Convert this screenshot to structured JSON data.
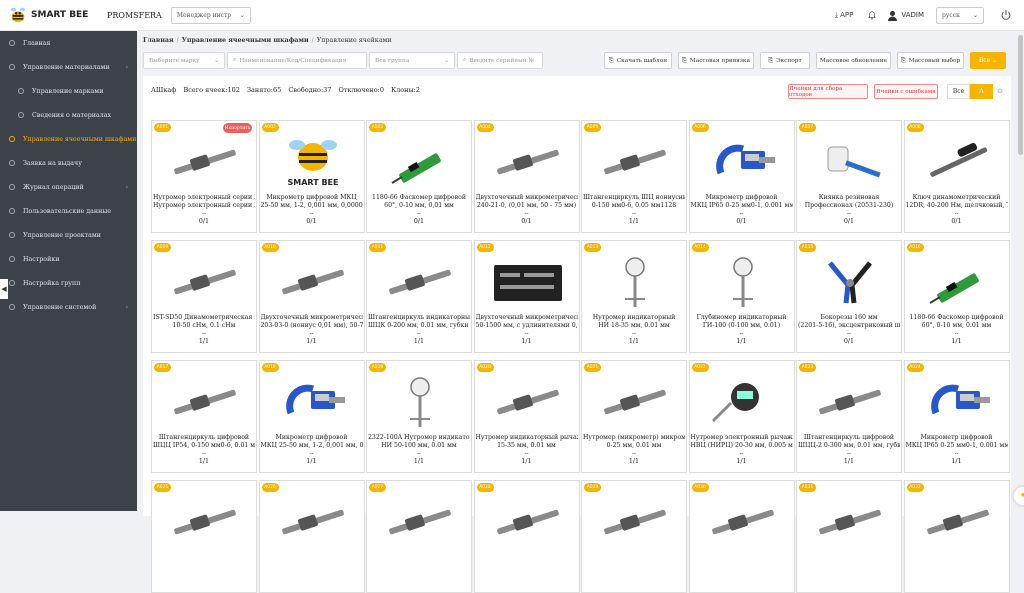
{
  "brand": {
    "name": "SMART BEE",
    "org": "PROMSFERA",
    "role_select": "Менеджер инстр",
    "accent": "#f5b400"
  },
  "header": {
    "app": "APP",
    "user": "VADIM",
    "lang": "русск"
  },
  "sidebar": {
    "items": [
      {
        "label": "Главная",
        "active": false,
        "sub": false,
        "arrow": false
      },
      {
        "label": "Управление материалами",
        "active": false,
        "sub": false,
        "arrow": true
      },
      {
        "label": "Управление марками",
        "active": false,
        "sub": true,
        "arrow": false
      },
      {
        "label": "Сведения о материалах",
        "active": false,
        "sub": true,
        "arrow": false
      },
      {
        "label": "Управление ячеечными шкафами",
        "active": true,
        "sub": false,
        "arrow": false
      },
      {
        "label": "Заявка на выдачу",
        "active": false,
        "sub": false,
        "arrow": false
      },
      {
        "label": "Журнал операций",
        "active": false,
        "sub": false,
        "arrow": true
      },
      {
        "label": "Пользовательские данные",
        "active": false,
        "sub": false,
        "arrow": false
      },
      {
        "label": "Управление проектами",
        "active": false,
        "sub": false,
        "arrow": false
      },
      {
        "label": "Настройки",
        "active": false,
        "sub": false,
        "arrow": false
      },
      {
        "label": "Настройка групп",
        "active": false,
        "sub": false,
        "arrow": false
      },
      {
        "label": "Управление системой",
        "active": false,
        "sub": false,
        "arrow": true
      }
    ]
  },
  "breadcrumb": {
    "home": "Главная",
    "section": "Управление ячеечными шкафами",
    "page": "Управление ячейками"
  },
  "filters": {
    "brand": "Выберите марку",
    "search": "Наименование/Код/Спецификация",
    "group": "Вся группа",
    "serial": "Введите серийный №"
  },
  "actions": {
    "download": "Скачать шаблон",
    "bulk_bind": "Массовая привязка",
    "export": "Экспорт",
    "bulk_update": "Массовое обновление",
    "bulk_select": "Массовый выбор",
    "all": "Все"
  },
  "stats": {
    "cabinet": "АШкаф",
    "total": "Всего ячеек:102",
    "busy": "Занято:65",
    "free": "Свободно:37",
    "off": "Отключено:0",
    "clones": "Клоны:2"
  },
  "tags": {
    "waste": "Ячейки для сбора отходов",
    "errors": "Ячейки с ошибками",
    "seg_all": "Все",
    "seg_a": "A"
  },
  "cells": [
    {
      "code": "A001",
      "name": "Нутромер электронный серии НИ",
      "name2": "Нутромер электронный серии НИ",
      "count": "0/1",
      "repair": "Испортить",
      "icon": "bore-gauge-icon"
    },
    {
      "code": "A002",
      "name": "Микрометр цифровой МКЦ",
      "name2": "25-50 мм, 1-2, 0,001 мм, 0,00005",
      "count": "0/1",
      "icon": "smartbee-logo-icon"
    },
    {
      "code": "A003",
      "name": "1180-66 Фаскомер цифровой",
      "name2": "60°, 0-10 мм, 0,01 мм",
      "count": "0/1",
      "icon": "chamfer-gauge-icon"
    },
    {
      "code": "A004",
      "name": "Двухточечный микрометрическ…",
      "name2": "240-21-0, (0,01 мм, 50 - 75 мм)",
      "count": "0/1",
      "icon": "micrometer-rod-icon"
    },
    {
      "code": "A005",
      "name": "Штангенциркуль ШЦ нониусный",
      "name2": "0-150 мм0-6, 0.05 мм1128",
      "count": "1/1",
      "icon": "caliper-icon"
    },
    {
      "code": "A006",
      "name": "Микрометр цифровой",
      "name2": "МКЦ IP65 0-25 мм0-1, 0.001 мм…",
      "count": "0/1",
      "icon": "digital-micrometer-icon"
    },
    {
      "code": "A007",
      "name": "Киянка резиновая",
      "name2": "Профессионал (20531-230)",
      "count": "0/1",
      "icon": "mallet-icon"
    },
    {
      "code": "A008",
      "name": "Ключ динамометрический",
      "name2": "12DR, 40-200 Нм, щелчковый, Т…",
      "count": "0/1",
      "icon": "torque-wrench-icon"
    },
    {
      "code": "A009",
      "name": "IST-SD50 Динамометрическая ц…",
      "name2": "10-50 сНм, 0.1 сНм",
      "count": "1/1",
      "icon": "torque-screwdriver-icon"
    },
    {
      "code": "A010",
      "name": "Двухточечный микрометрическ…",
      "name2": "203-03-0 (нониус 0,01 мм), 50-7…",
      "count": "1/1",
      "icon": "micrometer-head-icon"
    },
    {
      "code": "A011",
      "name": "Штангенциркуль индикаторный",
      "name2": "ШЦК 0-200 мм, 0.01 мм, губки …",
      "count": "1/1",
      "icon": "dial-caliper-icon"
    },
    {
      "code": "A012",
      "name": "Двухточечный микрометрическ…",
      "name2": "50-1500 мм, с удлинителями 0,0…",
      "count": "1/1",
      "icon": "case-set-icon"
    },
    {
      "code": "A013",
      "name": "Нутромер индикаторный",
      "name2": "НИ 18-35 мм, 0.01 мм",
      "count": "1/1",
      "icon": "dial-bore-gauge-icon"
    },
    {
      "code": "A014",
      "name": "Глубиномер индикаторный",
      "name2": "ГИ-100 (0-100 мм, 0.01)",
      "count": "1/1",
      "icon": "depth-gauge-icon"
    },
    {
      "code": "A015",
      "name": "Бокорезы 160 мм",
      "name2": "(2201-5-16), эксцентриковый ша…",
      "count": "0/1",
      "icon": "cutters-icon"
    },
    {
      "code": "A016",
      "name": "1180-66 Фаскомер цифровой",
      "name2": "60°, 0-10 мм, 0.01 мм",
      "count": "1/1",
      "icon": "chamfer-gauge-icon"
    },
    {
      "code": "A017",
      "name": "Штангенциркуль цифровой",
      "name2": "ШЦЦ IP54, 0-150 мм0-6, 0.01 м…",
      "count": "1/1",
      "icon": "digital-caliper-icon"
    },
    {
      "code": "A018",
      "name": "Микрометр цифровой",
      "name2": "МКЦ 25-50 мм, 1-2, 0,001 мм, 0…",
      "count": "1/1",
      "icon": "digital-micrometer-icon"
    },
    {
      "code": "A019",
      "name": "2322-100A Нутромер индикатор",
      "name2": "НИ 50-100 мм, 0.01 мм",
      "count": "1/1",
      "icon": "dial-bore-gauge-icon"
    },
    {
      "code": "A020",
      "name": "Нутромер индикаторный рычаж…",
      "name2": "15-35 мм, 0.01 мм",
      "count": "1/1",
      "icon": "lever-gauge-icon"
    },
    {
      "code": "A021",
      "name": "Нутромер (микрометр) микроме…",
      "name2": "0-25 мм, 0.01 мм",
      "count": "1/1",
      "icon": "micrometer-rod-icon"
    },
    {
      "code": "A022",
      "name": "Нутромер электронный рычажный",
      "name2": "НВЦ (НИРЦ) 20-30 мм, 0.005 мм",
      "count": "1/1",
      "icon": "electronic-lever-gauge-icon"
    },
    {
      "code": "A023",
      "name": "Штангенциркуль цифровой",
      "name2": "ШЦЦ-2 0-300 мм, 0.01 мм, губк…",
      "count": "1/1",
      "icon": "digital-caliper-icon"
    },
    {
      "code": "A024",
      "name": "Микрометр цифровой",
      "name2": "МКЦ IP65 0-25 мм0-1, 0.001 мм",
      "count": "1/1",
      "icon": "digital-micrometer-icon"
    },
    {
      "code": "A025",
      "name": "",
      "name2": "",
      "count": "",
      "icon": "tool-icon"
    },
    {
      "code": "A026",
      "name": "",
      "name2": "",
      "count": "",
      "icon": "tool-icon"
    },
    {
      "code": "A027",
      "name": "",
      "name2": "",
      "count": "",
      "icon": "tool-icon"
    },
    {
      "code": "A028",
      "name": "",
      "name2": "",
      "count": "",
      "icon": "tool-icon"
    },
    {
      "code": "A029",
      "name": "",
      "name2": "",
      "count": "",
      "icon": "tool-icon"
    },
    {
      "code": "A030",
      "name": "",
      "name2": "",
      "count": "",
      "icon": "tool-icon"
    },
    {
      "code": "A031",
      "name": "",
      "name2": "",
      "count": "",
      "icon": "tool-icon"
    },
    {
      "code": "A032",
      "name": "",
      "name2": "",
      "count": "",
      "icon": "tool-icon"
    }
  ]
}
